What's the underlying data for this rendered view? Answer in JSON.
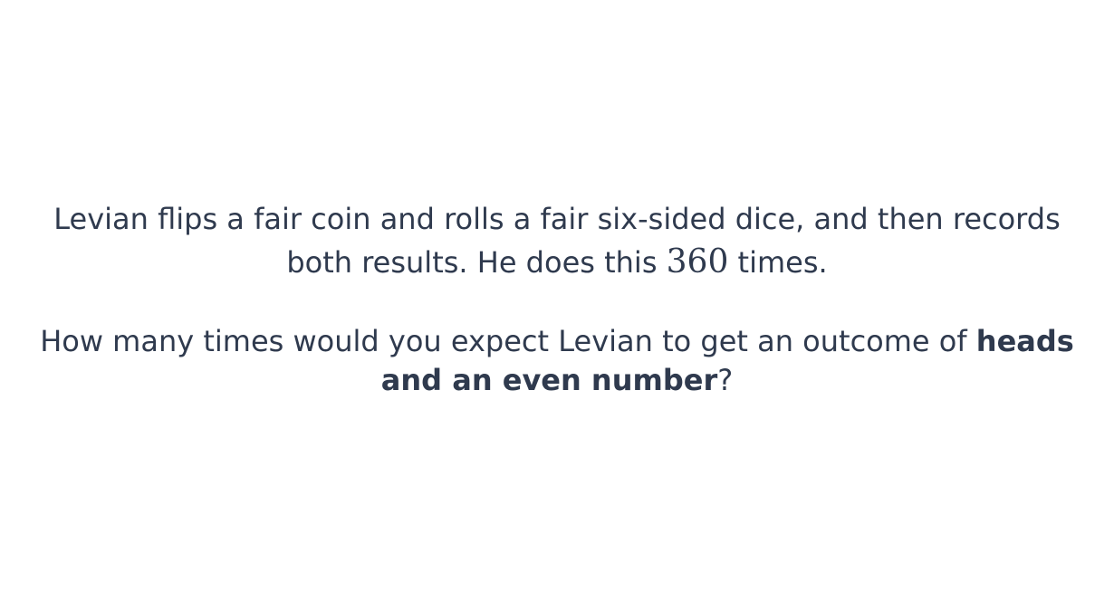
{
  "question": {
    "line1_part1": "Levian flips a fair coin and rolls a fair six-sided dice, and then records both results. He does this ",
    "number": "360",
    "line1_part2": " times.",
    "line2_part1": "How many times would you expect Levian to get an outcome of ",
    "bold_text": "heads and an even number",
    "line2_part2": "?"
  }
}
